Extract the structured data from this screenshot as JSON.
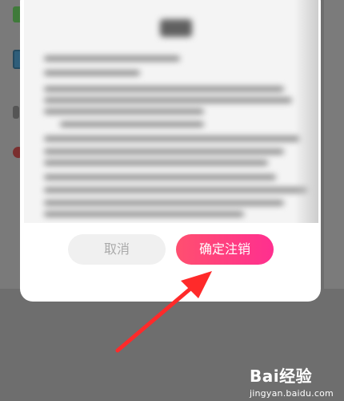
{
  "dialog": {
    "cancel_label": "取消",
    "confirm_label": "确定注销"
  },
  "watermark": {
    "brand": "Bai经验",
    "url": "jingyan.baidu.com"
  },
  "colors": {
    "confirm_gradient_start": "#ff4f70",
    "confirm_gradient_end": "#ff2f8f",
    "cancel_bg": "#f0f0f0",
    "arrow": "#ff2a2a",
    "overlay": "#6b6b6b"
  }
}
